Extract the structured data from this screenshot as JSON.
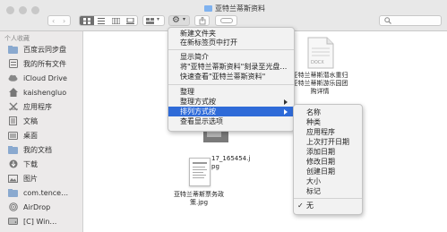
{
  "window": {
    "title": "亚特兰蒂斯资料"
  },
  "colors": {
    "accent": "#2f6bd8",
    "sidebar_bg": "#eceaea",
    "titlebar_bg": "#e8e8e8"
  },
  "sidebar": {
    "section_header": "个人收藏",
    "items": [
      {
        "label": "百度云同步盘",
        "icon": "folder-icon"
      },
      {
        "label": "我的所有文件",
        "icon": "all-files-icon"
      },
      {
        "label": "iCloud Drive",
        "icon": "cloud-icon"
      },
      {
        "label": "kaishengluo",
        "icon": "home-icon"
      },
      {
        "label": "应用程序",
        "icon": "applications-icon"
      },
      {
        "label": "文稿",
        "icon": "document-icon"
      },
      {
        "label": "桌面",
        "icon": "desktop-icon"
      },
      {
        "label": "我的文档",
        "icon": "folder-icon"
      },
      {
        "label": "下载",
        "icon": "download-icon"
      },
      {
        "label": "图片",
        "icon": "pictures-icon"
      },
      {
        "label": "com.tence…",
        "icon": "folder-icon"
      },
      {
        "label": "AirDrop",
        "icon": "airdrop-icon"
      },
      {
        "label": "[C] Win…",
        "icon": "drive-icon"
      }
    ]
  },
  "files": {
    "top_right_name": "亚特兰蒂斯潜水重归亚特兰蒂斯游乐园团购详情",
    "doc_badge": "DOCX",
    "partial_name": "17_165454.j pg",
    "bottom_name": "亚特兰蒂斯票务政策.jpg"
  },
  "context_menu": {
    "items": [
      "新建文件夹",
      "在新标签页中打开",
      "显示简介",
      "将\"亚特兰蒂斯资料\"刻录至光盘…",
      "快速查看\"亚特兰蒂斯资料\"",
      "整理",
      "整理方式按",
      "排列方式按",
      "查看显示选项"
    ]
  },
  "submenu": {
    "items": [
      "名称",
      "种类",
      "应用程序",
      "上次打开日期",
      "添加日期",
      "修改日期",
      "创建日期",
      "大小",
      "标记"
    ],
    "checked_item": "无"
  }
}
